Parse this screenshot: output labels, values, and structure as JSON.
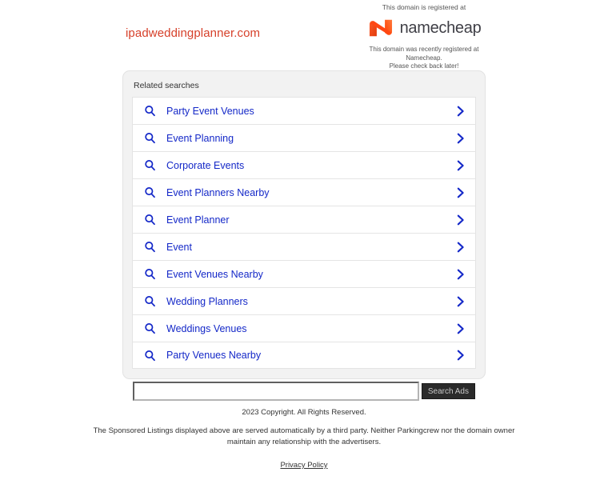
{
  "header": {
    "domain_name": "ipadweddingplanner.com",
    "domain_name_color": "#d6402a",
    "registrar_prefix": "This domain is registered at",
    "registrar_name": "namecheap",
    "registrar_logo_icon": "namecheap-n-logo",
    "registrar_logo_color": "#ff4713",
    "registrar_notice_line1": "This domain was recently registered at Namecheap.",
    "registrar_notice_line2": "Please check back later!"
  },
  "related": {
    "title": "Related searches",
    "link_color": "#1428c8",
    "items": [
      {
        "label": "Party Event Venues",
        "icon": "search-icon",
        "arrow": "chevron-right-icon"
      },
      {
        "label": "Event Planning",
        "icon": "search-icon",
        "arrow": "chevron-right-icon"
      },
      {
        "label": "Corporate Events",
        "icon": "search-icon",
        "arrow": "chevron-right-icon"
      },
      {
        "label": "Event Planners Nearby",
        "icon": "search-icon",
        "arrow": "chevron-right-icon"
      },
      {
        "label": "Event Planner",
        "icon": "search-icon",
        "arrow": "chevron-right-icon"
      },
      {
        "label": "Event",
        "icon": "search-icon",
        "arrow": "chevron-right-icon"
      },
      {
        "label": "Event Venues Nearby",
        "icon": "search-icon",
        "arrow": "chevron-right-icon"
      },
      {
        "label": "Wedding Planners",
        "icon": "search-icon",
        "arrow": "chevron-right-icon"
      },
      {
        "label": "Weddings Venues",
        "icon": "search-icon",
        "arrow": "chevron-right-icon"
      },
      {
        "label": "Party Venues Nearby",
        "icon": "search-icon",
        "arrow": "chevron-right-icon"
      }
    ]
  },
  "search": {
    "value": "",
    "placeholder": "",
    "button_label": "Search Ads"
  },
  "footer": {
    "copyright": "2023 Copyright. All Rights Reserved.",
    "disclaimer": "The Sponsored Listings displayed above are served automatically by a third party. Neither Parkingcrew nor the domain owner maintain any relationship with the advertisers.",
    "privacy_label": "Privacy Policy"
  }
}
